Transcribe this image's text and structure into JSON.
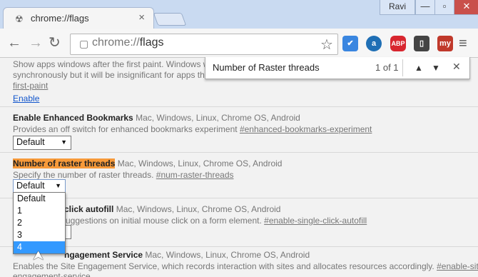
{
  "tab": {
    "title": "chrome://flags",
    "favicon": "radiation-icon"
  },
  "window": {
    "user": "Ravi",
    "minimize": "—",
    "restore": "▫",
    "close": "✕"
  },
  "toolbar": {
    "back": "←",
    "forward": "→",
    "reload": "↻",
    "url_scheme": "chrome://",
    "url_path": "flags",
    "extensions": [
      {
        "name": "checkmark-extension",
        "label": "✔",
        "color": "#3a86e0"
      },
      {
        "name": "a-extension",
        "label": "a",
        "color": "#1f6fb5"
      },
      {
        "name": "abp-extension",
        "label": "ABP",
        "color": "#d8262f"
      },
      {
        "name": "phone-extension",
        "label": "▯",
        "color": "#444444"
      },
      {
        "name": "my-extension",
        "label": "my",
        "color": "#c0392b"
      }
    ]
  },
  "find": {
    "query": "Number of Raster threads",
    "count": "1 of 1",
    "up": "▲",
    "down": "▼",
    "close": "✕"
  },
  "flags": {
    "first": {
      "desc_line1": "Show apps windows after the first paint. Windows will b",
      "desc_line2": "synchronously but it will be insignificant for apps that lo",
      "hash": "first-paint",
      "action": "Enable"
    },
    "bookmarks": {
      "title": "Enable Enhanced Bookmarks",
      "platforms": "Mac, Windows, Linux, Chrome OS, Android",
      "desc": "Provides an off switch for enhanced bookmarks experiment",
      "hash": "#enhanced-bookmarks-experiment",
      "select": "Default"
    },
    "raster": {
      "title": "Number of raster threads",
      "platforms": "Mac, Windows, Linux, Chrome OS, Android",
      "desc": "Specify the number of raster threads.",
      "hash": "#num-raster-threads",
      "select": "Default",
      "options": [
        "Default",
        "1",
        "2",
        "3",
        "4"
      ]
    },
    "autofill": {
      "title_partial": "click autofill",
      "platforms": "Mac, Windows, Linux, Chrome OS, Android",
      "desc_partial": "uggestions on initial mouse click on a form element.",
      "hash": "#enable-single-click-autofill"
    },
    "engagement": {
      "title_partial": "ngagement Service",
      "platforms": "Mac, Windows, Linux, Chrome OS, Android",
      "desc": "Enables the Site Engagement Service, which records interaction with sites and allocates resources accordingly.",
      "hash1": "#enable-site-",
      "hash2": "engagement-service"
    }
  }
}
